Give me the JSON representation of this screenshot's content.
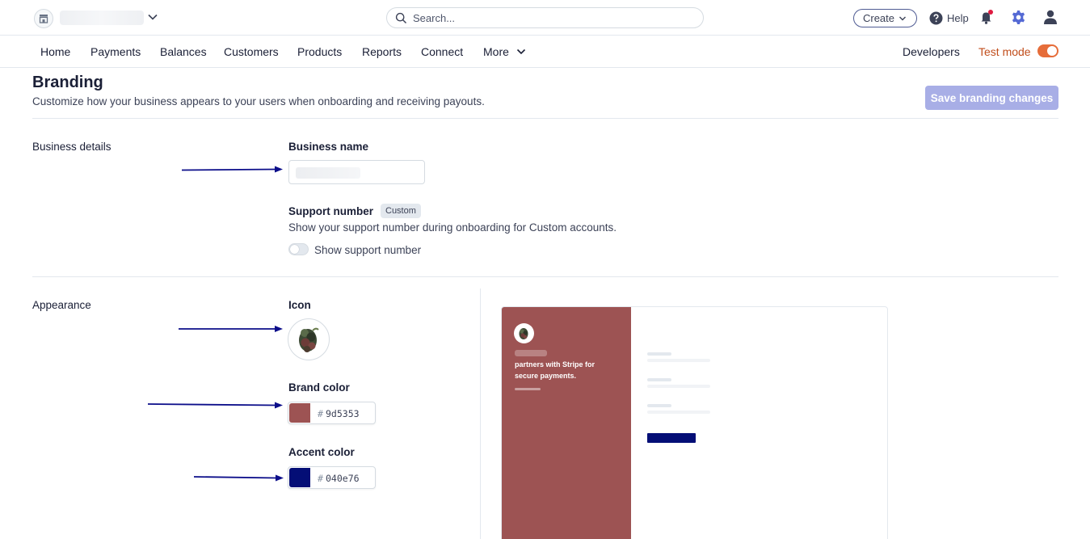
{
  "topbar": {
    "search_placeholder": "Search...",
    "create_label": "Create",
    "help_label": "Help"
  },
  "nav": {
    "items": [
      "Home",
      "Payments",
      "Balances",
      "Customers",
      "Products",
      "Reports",
      "Connect"
    ],
    "more_label": "More",
    "developers_label": "Developers",
    "test_mode_label": "Test mode",
    "test_mode_on": true
  },
  "header": {
    "title": "Branding",
    "subtitle": "Customize how your business appears to your users when onboarding and receiving payouts.",
    "save_label": "Save branding changes"
  },
  "business_details": {
    "section_label": "Business details",
    "business_name_label": "Business name",
    "support_number_label": "Support number",
    "support_badge": "Custom",
    "support_description": "Show your support number during onboarding for Custom accounts.",
    "show_support_label": "Show support number",
    "show_support_on": false
  },
  "appearance": {
    "section_label": "Appearance",
    "icon_label": "Icon",
    "brand_color_label": "Brand color",
    "brand_color_hash": "#",
    "brand_color_value": "9d5353",
    "accent_color_label": "Accent color",
    "accent_color_hash": "#",
    "accent_color_value": "040e76"
  },
  "preview": {
    "tagline": "partners with Stripe for secure payments."
  },
  "colors": {
    "brand": "#9d5353",
    "accent": "#040e76",
    "arrow": "#0c0e8a"
  }
}
